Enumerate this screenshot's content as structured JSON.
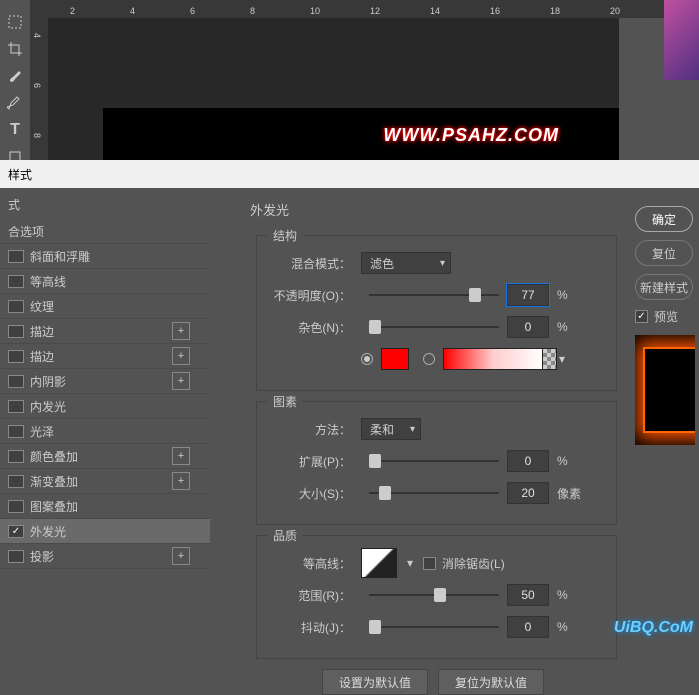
{
  "ruler_h": [
    "2",
    "4",
    "6",
    "8",
    "10",
    "12",
    "14",
    "16",
    "18",
    "20"
  ],
  "ruler_v": [
    "4",
    "6",
    "8"
  ],
  "canvas_url": "WWW.PSAHZ.COM",
  "dialog_title": "样式",
  "styles_header": "式",
  "styles": {
    "blend_options": "合选项",
    "bevel": "斜面和浮雕",
    "contour": "等高线",
    "texture": "纹理",
    "stroke1": "描边",
    "stroke2": "描边",
    "inner_shadow": "内阴影",
    "inner_glow": "内发光",
    "satin": "光泽",
    "color_overlay": "颜色叠加",
    "gradient_overlay": "渐变叠加",
    "pattern_overlay": "图案叠加",
    "outer_glow": "外发光",
    "drop_shadow": "投影"
  },
  "center": {
    "title": "外发光",
    "structure": "结构",
    "blend_mode_label": "混合模式：",
    "blend_mode_value": "滤色",
    "opacity_label": "不透明度(O)：",
    "opacity_value": "77",
    "percent": "%",
    "noise_label": "杂色(N)：",
    "noise_value": "0",
    "color_solid": "#ff0000",
    "elements": "图素",
    "method_label": "方法：",
    "method_value": "柔和",
    "spread_label": "扩展(P)：",
    "spread_value": "0",
    "size_label": "大小(S)：",
    "size_value": "20",
    "pixels": "像素",
    "quality": "品质",
    "contour_label": "等高线：",
    "antialias": "消除锯齿(L)",
    "range_label": "范围(R)：",
    "range_value": "50",
    "jitter_label": "抖动(J)：",
    "jitter_value": "0",
    "set_default": "设置为默认值",
    "reset_default": "复位为默认值"
  },
  "right": {
    "ok": "确定",
    "cancel": "复位",
    "new_style": "新建样式",
    "preview": "预览"
  },
  "watermark": "UiBQ.CoM"
}
